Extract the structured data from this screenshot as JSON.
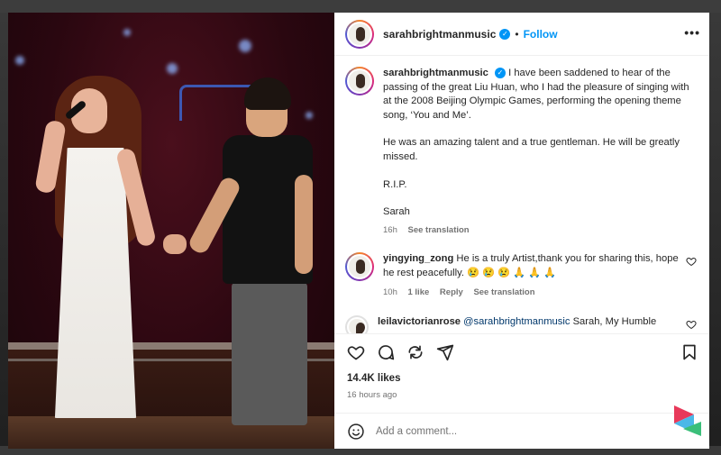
{
  "header": {
    "username": "sarahbrightmanmusic",
    "separator": "•",
    "follow_label": "Follow",
    "more_label": "•••"
  },
  "caption": {
    "username": "sarahbrightmanmusic",
    "lines": [
      "I have been saddened to hear of the passing of the great Liu Huan, who I had the pleasure of singing with at the 2008 Beijing Olympic Games, performing the opening theme song, ‘You and Me’.",
      "He was an amazing talent and a true gentleman. He will be greatly missed.",
      "R.I.P.",
      "Sarah"
    ],
    "time": "16h",
    "see_translation": "See translation"
  },
  "comments": [
    {
      "username": "yingying_zong",
      "text": "He is a truly Artist,thank you for sharing this, hope he rest peacefully. 😢 😢 😢 🙏 🙏 🙏",
      "time": "10h",
      "likes": "1 like",
      "reply": "Reply",
      "see_translation": "See translation"
    },
    {
      "username": "leilavictorianrose",
      "mention": "@sarahbrightmanmusic",
      "text": "Sarah, My Humble"
    }
  ],
  "post": {
    "likes": "14.4K likes",
    "posted_ago": "16 hours ago"
  },
  "composer": {
    "placeholder": "Add a comment..."
  },
  "colors": {
    "accent": "#0095f6",
    "muted": "#737373",
    "text": "#262626"
  },
  "icons": [
    "heart-icon",
    "comment-icon",
    "share-icon",
    "send-icon",
    "bookmark-icon",
    "emoji-icon",
    "verified-badge-icon",
    "more-icon"
  ]
}
